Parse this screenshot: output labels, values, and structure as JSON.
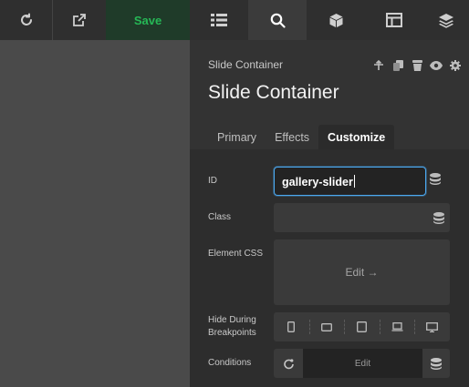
{
  "toolbar": {
    "refresh_icon": "refresh-icon",
    "external_icon": "external-link-icon",
    "save_label": "Save",
    "tools": [
      "list-icon",
      "search-icon",
      "cube-icon",
      "layout-icon",
      "layers-icon"
    ],
    "active_tool": "search-icon"
  },
  "panel": {
    "breadcrumb": "Slide Container",
    "title": "Slide Container",
    "actions": [
      "move-icon",
      "duplicate-icon",
      "delete-icon",
      "visibility-icon",
      "settings-icon"
    ],
    "tabs": [
      {
        "label": "Primary",
        "active": false
      },
      {
        "label": "Effects",
        "active": false
      },
      {
        "label": "Customize",
        "active": true
      }
    ]
  },
  "fields": {
    "id": {
      "label": "ID",
      "value": "gallery-slider"
    },
    "class": {
      "label": "Class",
      "value": ""
    },
    "element_css": {
      "label": "Element CSS",
      "button": "Edit →"
    },
    "hide_during": {
      "label_line1": "Hide During",
      "label_line2": "Breakpoints",
      "breakpoints": [
        "phone-portrait-icon",
        "phone-landscape-icon",
        "tablet-icon",
        "laptop-icon",
        "desktop-icon"
      ]
    },
    "conditions": {
      "label": "Conditions",
      "button": "Edit"
    }
  },
  "colors": {
    "accent_green": "#26b856",
    "focus_blue": "#4ba8f0"
  }
}
